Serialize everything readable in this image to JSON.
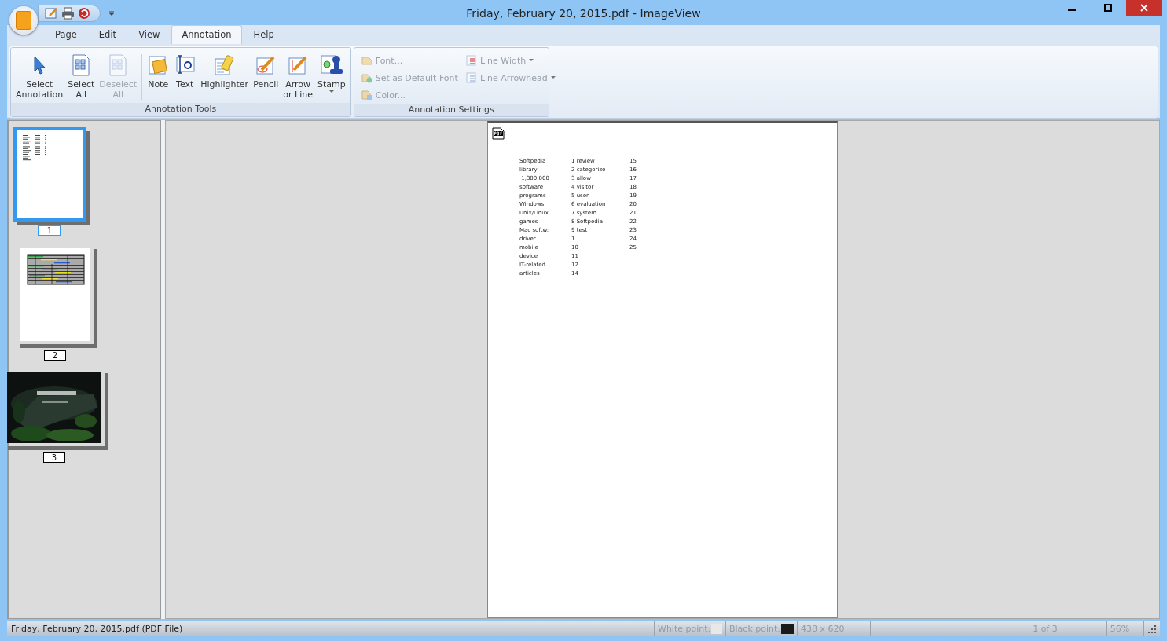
{
  "window": {
    "title": "Friday, February 20, 2015.pdf - ImageView"
  },
  "tabs": [
    {
      "label": "Page",
      "selected": false
    },
    {
      "label": "Edit",
      "selected": false
    },
    {
      "label": "View",
      "selected": false
    },
    {
      "label": "Annotation",
      "selected": true
    },
    {
      "label": "Help",
      "selected": false
    }
  ],
  "ribbon": {
    "groups": [
      {
        "title": "Annotation Tools",
        "buttons": [
          {
            "label": "Select\nAnnotation",
            "disabled": false
          },
          {
            "label": "Select\nAll",
            "disabled": false
          },
          {
            "label": "Deselect\nAll",
            "disabled": true
          },
          {
            "label": "Note",
            "disabled": false
          },
          {
            "label": "Text",
            "disabled": false
          },
          {
            "label": "Highlighter",
            "disabled": false
          },
          {
            "label": "Pencil",
            "disabled": false
          },
          {
            "label": "Arrow\nor Line",
            "disabled": false
          },
          {
            "label": "Stamp",
            "disabled": false,
            "dropdown": true
          }
        ]
      },
      {
        "title": "Annotation Settings",
        "items": [
          {
            "label": "Font...",
            "disabled": true
          },
          {
            "label": "Line Width",
            "disabled": true,
            "dropdown": true
          },
          {
            "label": "Set as Default Font",
            "disabled": true
          },
          {
            "label": "Line Arrowhead",
            "disabled": true,
            "dropdown": true
          },
          {
            "label": "Color...",
            "disabled": true
          }
        ]
      }
    ]
  },
  "thumbnails": [
    {
      "label": "1",
      "kind": "text",
      "selected": true
    },
    {
      "label": "2",
      "kind": "table",
      "selected": false
    },
    {
      "label": "3",
      "kind": "picture",
      "selected": false
    }
  ],
  "document": {
    "rows": [
      [
        "Softpedia",
        "1 review",
        "15"
      ],
      [
        "library",
        "2 categorize",
        "16"
      ],
      [
        " 1,300,000",
        "3 allow",
        "17"
      ],
      [
        "software",
        "4 visitor",
        "18"
      ],
      [
        "programs",
        "5 user",
        "19"
      ],
      [
        "Windows",
        "6 evaluation",
        "20"
      ],
      [
        "Unix/Linux",
        "7 system",
        "21"
      ],
      [
        "games",
        "8 Softpedia",
        "22"
      ],
      [
        "Mac softw:",
        "9 test",
        "23"
      ],
      [
        "driver",
        "1",
        "24"
      ],
      [
        "mobile",
        "10",
        "25"
      ],
      [
        "device",
        "11"
      ],
      [
        "IT-related",
        "12"
      ],
      [
        "articles",
        "14"
      ]
    ]
  },
  "status_bar": {
    "file": "Friday, February 20, 2015.pdf (PDF File)",
    "white_point": "White point:",
    "black_point": "Black point:",
    "size": "438 x 620",
    "page": "1 of 3",
    "zoom": "56%"
  }
}
